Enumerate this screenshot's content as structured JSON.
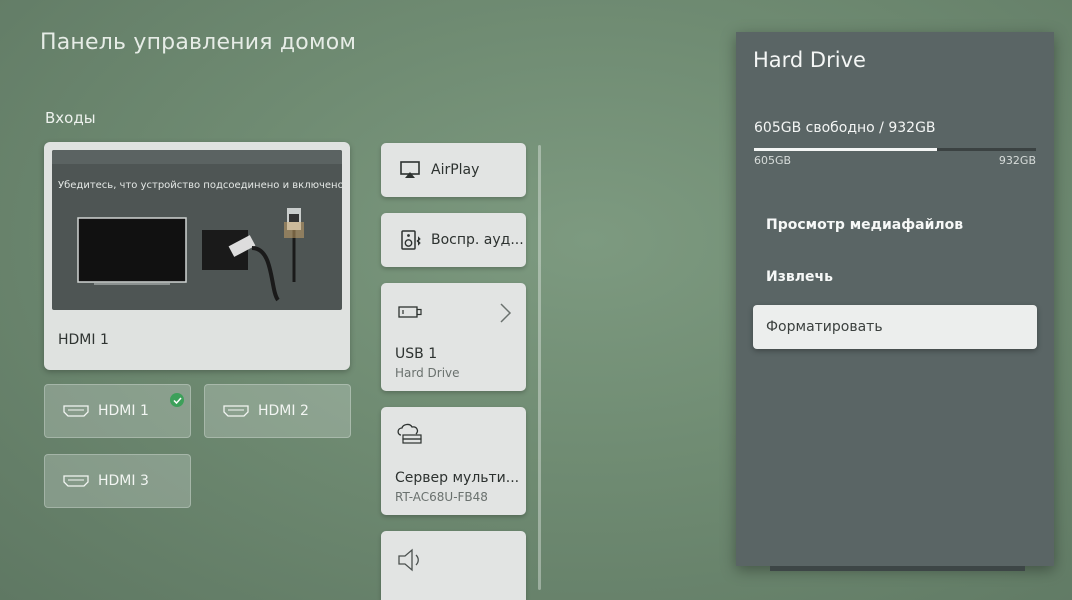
{
  "page": {
    "title": "Панель управления домом"
  },
  "inputs": {
    "section_label": "Входы",
    "preview": {
      "hint": "Убедитесь, что устройство подсоединено и включено.",
      "label": "HDMI 1"
    },
    "tiles": [
      {
        "label": "HDMI 1",
        "connected": true
      },
      {
        "label": "HDMI 2",
        "connected": false
      },
      {
        "label": "HDMI 3",
        "connected": false
      }
    ]
  },
  "devices": [
    {
      "label": "AirPlay",
      "icon": "airplay-icon"
    },
    {
      "label": "Воспр. ауд...",
      "icon": "speaker-bluetooth-icon"
    },
    {
      "label": "USB 1",
      "sub": "Hard Drive",
      "icon": "usb-icon"
    },
    {
      "label": "Сервер мульти...",
      "sub": "RT-AC68U-FB48",
      "icon": "media-server-icon"
    },
    {
      "label": "",
      "icon": "sound-output-icon"
    }
  ],
  "panel": {
    "title": "Hard Drive",
    "storage_text": "605GB свободно / 932GB",
    "bar_min": "605GB",
    "bar_max": "932GB",
    "free_fraction": 0.65,
    "menu": [
      {
        "label": "Просмотр медиафайлов"
      },
      {
        "label": "Извлечь"
      },
      {
        "label": "Форматировать",
        "selected": true
      }
    ]
  },
  "colors": {
    "background": "#6f8b72",
    "panel": "#5a6565",
    "card": "#e2e4e3",
    "check": "#3da05a"
  }
}
